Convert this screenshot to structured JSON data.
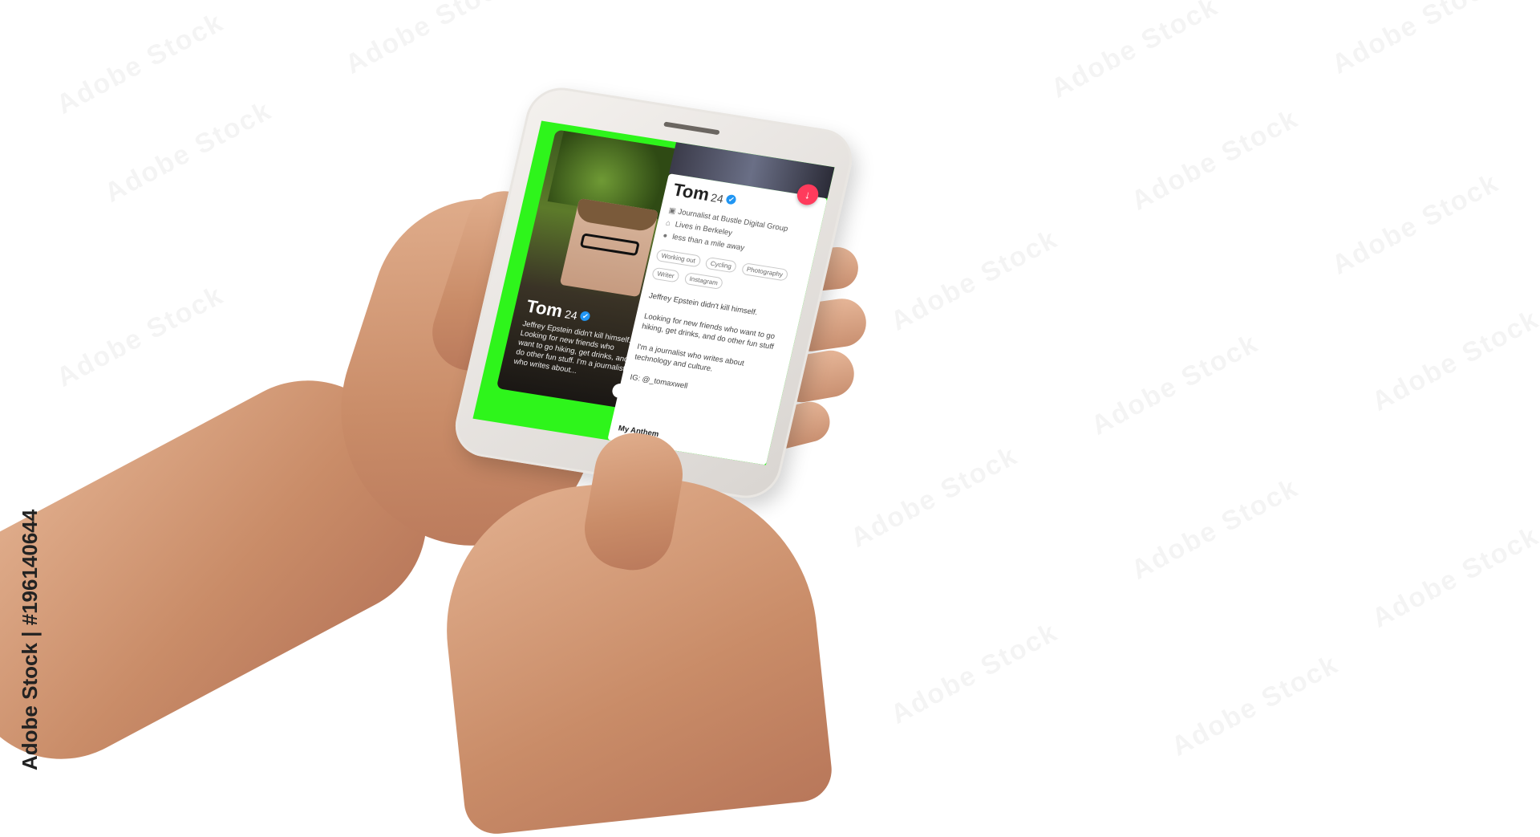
{
  "watermark": {
    "text": "Adobe Stock"
  },
  "credit": {
    "text": "Adobe Stock | #196140644"
  },
  "colors": {
    "screen_bg": "#2ef51b",
    "dislike": "#ff3b5c",
    "verified": "#2196f3"
  },
  "profile": {
    "name": "Tom",
    "age": "24",
    "card_text": "Jeffrey Epstein didn't kill himself. Looking for new friends who want to go hiking, get drinks, and do other fun stuff. I'm a journalist who writes about...",
    "info_icon": "info-icon",
    "job": "Journalist at Bustle Digital Group",
    "location": "Lives in Berkeley",
    "distance": "less than a mile away",
    "tags": [
      "Working out",
      "Cycling",
      "Photography",
      "Writer",
      "Instagram"
    ],
    "bio": [
      "Jeffrey Epstein didn't kill himself.",
      "Looking for new friends who want to go hiking, get drinks, and do other fun stuff",
      "I'm a journalist who writes about technology and culture.",
      "IG: @_tomaxwell"
    ],
    "anthem_label": "My Anthem"
  }
}
